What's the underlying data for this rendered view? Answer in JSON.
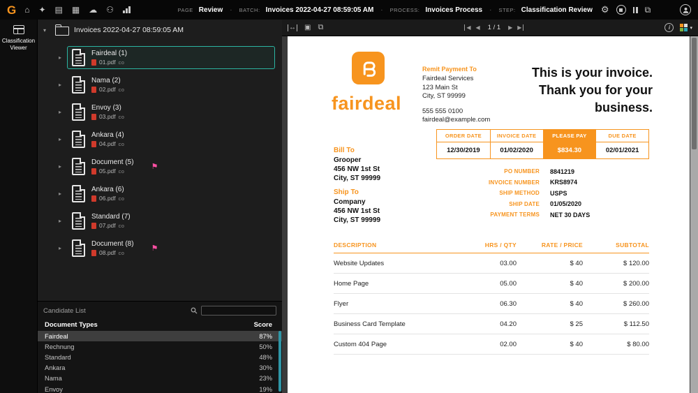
{
  "colors": {
    "accent": "#F7941E",
    "selection": "#2CB5A2",
    "flag": "#FF4FA3",
    "scrollbar": "#2F96A6"
  },
  "icons": {
    "home": "⌂",
    "tasks": "✦",
    "archive": "▤",
    "import": "▦",
    "cloud_upload": "☁",
    "users": "⚇",
    "gear": "⚙",
    "journal": "⧉",
    "help": "?",
    "caret_down": "▾",
    "caret_right": "▸",
    "flag": "⚑",
    "fit_width": "↔",
    "select_area": "▣",
    "pages": "⧉",
    "nav_prev": "◀",
    "nav_next": "▶",
    "info": "i",
    "layout_caret": "▾"
  },
  "topbar": {
    "logo": "G",
    "page_label": "PAGE",
    "page_value": "Review",
    "batch_label": "BATCH:",
    "batch_value": "Invoices 2022-04-27 08:59:05 AM",
    "process_label": "PROCESS:",
    "process_value": "Invoices Process",
    "step_label": "STEP:",
    "step_value": "Classification Review",
    "separator": "·"
  },
  "rail": {
    "label": "Classification Viewer"
  },
  "tree": {
    "root_label": "Invoices 2022-04-27 08:59:05 AM",
    "items": [
      {
        "label": "Fairdeal (1)",
        "file": "01.pdf",
        "suffix": "co"
      },
      {
        "label": "Nama (2)",
        "file": "02.pdf",
        "suffix": "co"
      },
      {
        "label": "Envoy (3)",
        "file": "03.pdf",
        "suffix": "co"
      },
      {
        "label": "Ankara (4)",
        "file": "04.pdf",
        "suffix": "co"
      },
      {
        "label": "Document (5)",
        "file": "05.pdf",
        "suffix": "co"
      },
      {
        "label": "Ankara (6)",
        "file": "06.pdf",
        "suffix": "co"
      },
      {
        "label": "Standard (7)",
        "file": "07.pdf",
        "suffix": "co"
      },
      {
        "label": "Document (8)",
        "file": "08.pdf",
        "suffix": "co"
      }
    ]
  },
  "candidates": {
    "title": "Candidate List",
    "search_placeholder": "",
    "col_type": "Document Types",
    "col_score": "Score",
    "rows": [
      {
        "name": "Fairdeal",
        "score": "87%"
      },
      {
        "name": "Rechnung",
        "score": "50%"
      },
      {
        "name": "Standard",
        "score": "48%"
      },
      {
        "name": "Ankara",
        "score": "30%"
      },
      {
        "name": "Nama",
        "score": "23%"
      },
      {
        "name": "Envoy",
        "score": "19%"
      }
    ]
  },
  "viewer": {
    "page_indicator": "1 / 1"
  },
  "invoice": {
    "brand": "fairdeal",
    "remit": {
      "title": "Remit Payment To",
      "lines": [
        "Fairdeal Services",
        "123 Main St",
        "City, ST 99999"
      ],
      "phone": "555 555 0100",
      "email": "fairdeal@example.com"
    },
    "headline": [
      "This is your invoice.",
      "Thank you for your",
      "business."
    ],
    "summary": {
      "headers": [
        "ORDER DATE",
        "INVOICE DATE",
        "PLEASE PAY",
        "DUE DATE"
      ],
      "values": [
        "12/30/2019",
        "01/02/2020",
        "$834.30",
        "02/01/2021"
      ]
    },
    "bill_to": {
      "title": "Bill To",
      "lines": [
        "Grooper",
        "456 NW 1st St",
        "City, ST 99999"
      ]
    },
    "ship_to": {
      "title": "Ship To",
      "lines": [
        "Company",
        "456 NW 1st St",
        "City, ST 99999"
      ]
    },
    "details": [
      {
        "label": "PO NUMBER",
        "value": "8841219"
      },
      {
        "label": "INVOICE NUMBER",
        "value": "KRS8974"
      },
      {
        "label": "SHIP METHOD",
        "value": "USPS"
      },
      {
        "label": "SHIP DATE",
        "value": "01/05/2020"
      },
      {
        "label": "PAYMENT TERMS",
        "value": "NET 30 DAYS"
      }
    ],
    "items": {
      "headers": [
        "DESCRIPTION",
        "HRS / QTY",
        "RATE / PRICE",
        "SUBTOTAL"
      ],
      "rows": [
        [
          "Website Updates",
          "03.00",
          "$ 40",
          "$ 120.00"
        ],
        [
          "Home Page",
          "05.00",
          "$ 40",
          "$ 200.00"
        ],
        [
          "Flyer",
          "06.30",
          "$ 40",
          "$ 260.00"
        ],
        [
          "Business Card Template",
          "04.20",
          "$ 25",
          "$ 112.50"
        ],
        [
          "Custom 404 Page",
          "02.00",
          "$ 40",
          "$ 80.00"
        ]
      ]
    }
  }
}
